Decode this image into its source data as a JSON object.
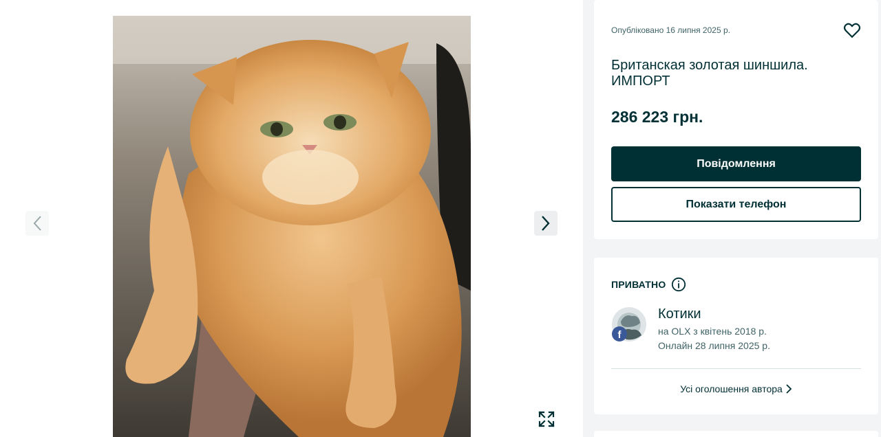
{
  "listing": {
    "published": "Опубліковано 16 липня 2025 р.",
    "title": "Британская золотая шиншила. ИМПОРТ",
    "price": "286 223 грн.",
    "message_button": "Повідомлення",
    "phone_button": "Показати телефон"
  },
  "seller": {
    "type_label": "ПРИВАТНО",
    "name": "Котики",
    "since": "на OLX з квітень 2018 р.",
    "online": "Онлайн 28 липня 2025 р.",
    "all_ads_link": "Усі оголошення автора"
  },
  "icons": {
    "favorite": "heart-outline-icon",
    "info": "info-circle-icon",
    "prev": "chevron-left-icon",
    "next": "chevron-right-icon",
    "expand": "expand-icon",
    "social": "facebook-badge-icon"
  },
  "colors": {
    "primary": "#002f34",
    "secondary_text": "#406367",
    "page_bg": "#f2f4f5",
    "facebook": "#3b5998"
  }
}
